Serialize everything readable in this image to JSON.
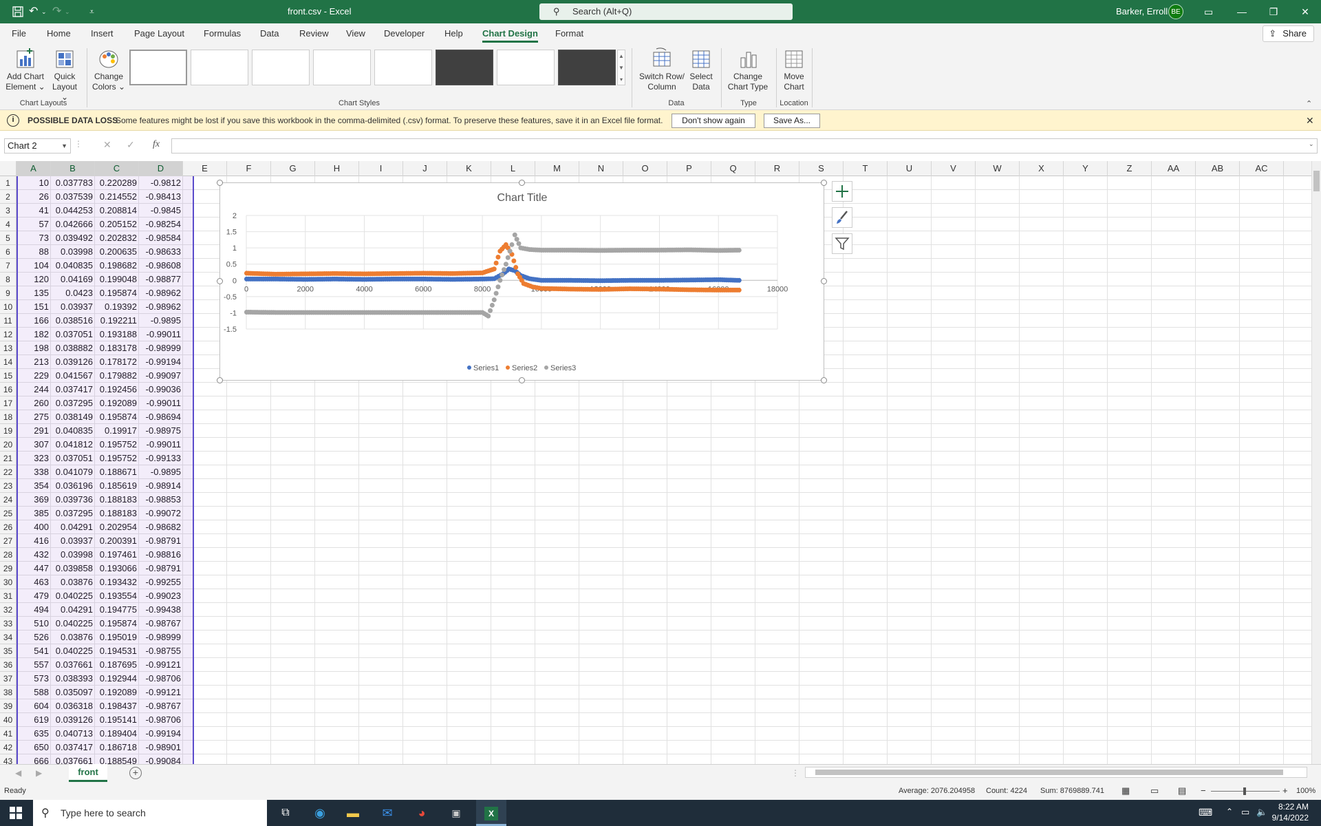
{
  "window": {
    "title": "front.csv  -  Excel",
    "search_placeholder": "Search (Alt+Q)",
    "user_name": "Barker, Erroll",
    "user_initials": "BE"
  },
  "menu": {
    "tabs": [
      "File",
      "Home",
      "Insert",
      "Page Layout",
      "Formulas",
      "Data",
      "Review",
      "View",
      "Developer",
      "Help",
      "Chart Design",
      "Format"
    ],
    "active_tab": "Chart Design",
    "share_label": "Share"
  },
  "ribbon": {
    "add_chart_element": [
      "Add Chart",
      "Element ⌄"
    ],
    "quick_layout": [
      "Quick",
      "Layout ⌄"
    ],
    "change_colors": [
      "Change",
      "Colors ⌄"
    ],
    "switch_row_col": [
      "Switch Row/",
      "Column"
    ],
    "select_data": [
      "Select",
      "Data"
    ],
    "change_chart_type": [
      "Change",
      "Chart Type"
    ],
    "move_chart": [
      "Move",
      "Chart"
    ],
    "groups": {
      "chart_layouts": "Chart Layouts",
      "chart_styles": "Chart Styles",
      "data": "Data",
      "type": "Type",
      "location": "Location"
    }
  },
  "message_bar": {
    "title": "POSSIBLE DATA LOSS",
    "text": "Some features might be lost if you save this workbook in the comma-delimited (.csv) format. To preserve these features, save it in an Excel file format.",
    "dont_show_label": "Don't show again",
    "save_as_label": "Save As..."
  },
  "formula_bar": {
    "name_box": "Chart 2",
    "fx": "fx",
    "value": ""
  },
  "columns": [
    "A",
    "B",
    "C",
    "D",
    "E",
    "F",
    "G",
    "H",
    "I",
    "J",
    "K",
    "L",
    "M",
    "N",
    "O",
    "P",
    "Q",
    "R",
    "S",
    "T",
    "U",
    "V",
    "W",
    "X",
    "Y",
    "Z",
    "AA",
    "AB",
    "AC"
  ],
  "rows": [
    [
      "1",
      "10",
      "0.037783",
      "0.220289",
      "-0.9812"
    ],
    [
      "2",
      "26",
      "0.037539",
      "0.214552",
      "-0.98413"
    ],
    [
      "3",
      "41",
      "0.044253",
      "0.208814",
      "-0.9845"
    ],
    [
      "4",
      "57",
      "0.042666",
      "0.205152",
      "-0.98254"
    ],
    [
      "5",
      "73",
      "0.039492",
      "0.202832",
      "-0.98584"
    ],
    [
      "6",
      "88",
      "0.03998",
      "0.200635",
      "-0.98633"
    ],
    [
      "7",
      "104",
      "0.040835",
      "0.198682",
      "-0.98608"
    ],
    [
      "8",
      "120",
      "0.04169",
      "0.199048",
      "-0.98877"
    ],
    [
      "9",
      "135",
      "0.0423",
      "0.195874",
      "-0.98962"
    ],
    [
      "10",
      "151",
      "0.03937",
      "0.19392",
      "-0.98962"
    ],
    [
      "11",
      "166",
      "0.038516",
      "0.192211",
      "-0.9895"
    ],
    [
      "12",
      "182",
      "0.037051",
      "0.193188",
      "-0.99011"
    ],
    [
      "13",
      "198",
      "0.038882",
      "0.183178",
      "-0.98999"
    ],
    [
      "14",
      "213",
      "0.039126",
      "0.178172",
      "-0.99194"
    ],
    [
      "15",
      "229",
      "0.041567",
      "0.179882",
      "-0.99097"
    ],
    [
      "16",
      "244",
      "0.037417",
      "0.192456",
      "-0.99036"
    ],
    [
      "17",
      "260",
      "0.037295",
      "0.192089",
      "-0.99011"
    ],
    [
      "18",
      "275",
      "0.038149",
      "0.195874",
      "-0.98694"
    ],
    [
      "19",
      "291",
      "0.040835",
      "0.19917",
      "-0.98975"
    ],
    [
      "20",
      "307",
      "0.041812",
      "0.195752",
      "-0.99011"
    ],
    [
      "21",
      "323",
      "0.037051",
      "0.195752",
      "-0.99133"
    ],
    [
      "22",
      "338",
      "0.041079",
      "0.188671",
      "-0.9895"
    ],
    [
      "23",
      "354",
      "0.036196",
      "0.185619",
      "-0.98914"
    ],
    [
      "24",
      "369",
      "0.039736",
      "0.188183",
      "-0.98853"
    ],
    [
      "25",
      "385",
      "0.037295",
      "0.188183",
      "-0.99072"
    ],
    [
      "26",
      "400",
      "0.04291",
      "0.202954",
      "-0.98682"
    ],
    [
      "27",
      "416",
      "0.03937",
      "0.200391",
      "-0.98791"
    ],
    [
      "28",
      "432",
      "0.03998",
      "0.197461",
      "-0.98816"
    ],
    [
      "29",
      "447",
      "0.039858",
      "0.193066",
      "-0.98791"
    ],
    [
      "30",
      "463",
      "0.03876",
      "0.193432",
      "-0.99255"
    ],
    [
      "31",
      "479",
      "0.040225",
      "0.193554",
      "-0.99023"
    ],
    [
      "32",
      "494",
      "0.04291",
      "0.194775",
      "-0.99438"
    ],
    [
      "33",
      "510",
      "0.040225",
      "0.195874",
      "-0.98767"
    ],
    [
      "34",
      "526",
      "0.03876",
      "0.195019",
      "-0.98999"
    ],
    [
      "35",
      "541",
      "0.040225",
      "0.194531",
      "-0.98755"
    ],
    [
      "36",
      "557",
      "0.037661",
      "0.187695",
      "-0.99121"
    ],
    [
      "37",
      "573",
      "0.038393",
      "0.192944",
      "-0.98706"
    ],
    [
      "38",
      "588",
      "0.035097",
      "0.192089",
      "-0.99121"
    ],
    [
      "39",
      "604",
      "0.036318",
      "0.198437",
      "-0.98767"
    ],
    [
      "40",
      "619",
      "0.039126",
      "0.195141",
      "-0.98706"
    ],
    [
      "41",
      "635",
      "0.040713",
      "0.189404",
      "-0.99194"
    ],
    [
      "42",
      "650",
      "0.037417",
      "0.186718",
      "-0.98901"
    ],
    [
      "43",
      "666",
      "0.037661",
      "0.188549",
      "-0.99084"
    ]
  ],
  "chart_data": {
    "type": "scatter",
    "title": "Chart Title",
    "xlim": [
      0,
      18000
    ],
    "ylim": [
      -1.5,
      2
    ],
    "x_ticks": [
      "0",
      "2000",
      "4000",
      "6000",
      "8000",
      "10000",
      "12000",
      "14000",
      "16000",
      "18000"
    ],
    "y_ticks": [
      "2",
      "1.5",
      "1",
      "0.5",
      "0",
      "-0.5",
      "-1",
      "-1.5"
    ],
    "legend_position": "bottom",
    "series": [
      {
        "name": "Series1",
        "color": "#4472c4",
        "x": [
          10,
          1000,
          2000,
          3000,
          4000,
          5000,
          6000,
          7000,
          8000,
          8400,
          8700,
          8900,
          9100,
          9300,
          9600,
          10000,
          11000,
          12000,
          13000,
          14000,
          15000,
          16000,
          16700
        ],
        "y": [
          0.04,
          0.04,
          0.03,
          0.04,
          0.03,
          0.04,
          0.04,
          0.03,
          0.04,
          0.05,
          0.2,
          0.35,
          0.3,
          0.15,
          0.05,
          0.0,
          0.0,
          -0.01,
          0.0,
          0.0,
          0.01,
          0.02,
          0.0
        ]
      },
      {
        "name": "Series2",
        "color": "#ed7d31",
        "x": [
          10,
          1000,
          2000,
          3000,
          4000,
          5000,
          6000,
          7000,
          8000,
          8400,
          8600,
          8800,
          9000,
          9200,
          9400,
          9700,
          10000,
          11000,
          12000,
          13000,
          14000,
          15000,
          16000,
          16700
        ],
        "y": [
          0.22,
          0.19,
          0.2,
          0.21,
          0.2,
          0.21,
          0.22,
          0.21,
          0.23,
          0.35,
          0.9,
          1.1,
          0.8,
          0.2,
          -0.1,
          -0.2,
          -0.25,
          -0.27,
          -0.28,
          -0.26,
          -0.27,
          -0.29,
          -0.3,
          -0.3
        ]
      },
      {
        "name": "Series3",
        "color": "#a5a5a5",
        "x": [
          10,
          1000,
          2000,
          3000,
          4000,
          5000,
          6000,
          7000,
          8000,
          8200,
          8400,
          8600,
          8800,
          9000,
          9100,
          9300,
          9600,
          10000,
          11000,
          12000,
          13000,
          14000,
          15000,
          16000,
          16700
        ],
        "y": [
          -0.98,
          -0.99,
          -0.99,
          -0.99,
          -0.99,
          -0.99,
          -0.99,
          -0.99,
          -0.99,
          -1.1,
          -0.6,
          0.0,
          0.5,
          1.1,
          1.4,
          1.0,
          0.95,
          0.93,
          0.93,
          0.92,
          0.93,
          0.93,
          0.94,
          0.92,
          0.93
        ]
      }
    ]
  },
  "sheets": {
    "active": "front"
  },
  "status": {
    "ready": "Ready",
    "average": "Average: 2076.204958",
    "count": "Count: 4224",
    "sum": "Sum: 8769889.741",
    "zoom": "100%"
  },
  "taskbar": {
    "search_placeholder": "Type here to search",
    "time": "8:22 AM",
    "date": "9/14/2022"
  },
  "colors": {
    "excel_green": "#217346",
    "selection_range": "#5b4bcc"
  }
}
